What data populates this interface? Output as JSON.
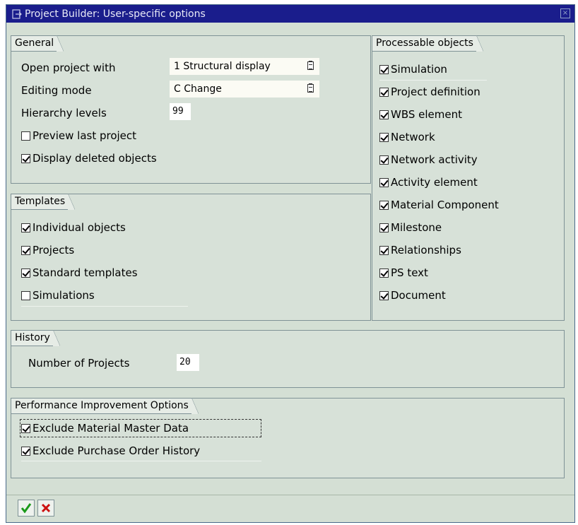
{
  "window": {
    "title": "Project Builder: User-specific options"
  },
  "general": {
    "label": "General",
    "open_project_label": "Open project with",
    "open_project_value": "1 Structural display",
    "editing_mode_label": "Editing mode",
    "editing_mode_value": "C Change",
    "hierarchy_levels_label": "Hierarchy levels",
    "hierarchy_levels_value": "99",
    "preview_last_project": {
      "label": "Preview last project",
      "checked": false
    },
    "display_deleted_objects": {
      "label": "Display deleted objects",
      "checked": true
    }
  },
  "templates": {
    "label": "Templates",
    "items": [
      {
        "label": "Individual objects",
        "checked": true
      },
      {
        "label": "Projects",
        "checked": true
      },
      {
        "label": "Standard templates",
        "checked": true
      },
      {
        "label": "Simulations",
        "checked": false
      }
    ]
  },
  "processable": {
    "label": "Processable objects",
    "items": [
      {
        "label": "Simulation",
        "checked": true
      },
      {
        "label": "Project definition",
        "checked": true
      },
      {
        "label": "WBS element",
        "checked": true
      },
      {
        "label": "Network",
        "checked": true
      },
      {
        "label": "Network activity",
        "checked": true
      },
      {
        "label": "Activity element",
        "checked": true
      },
      {
        "label": "Material Component",
        "checked": true
      },
      {
        "label": "Milestone",
        "checked": true
      },
      {
        "label": "Relationships",
        "checked": true
      },
      {
        "label": "PS text",
        "checked": true
      },
      {
        "label": "Document",
        "checked": true
      }
    ]
  },
  "history": {
    "label": "History",
    "number_of_projects_label": "Number of Projects",
    "number_of_projects_value": "20"
  },
  "performance": {
    "label": "Performance Improvement Options",
    "items": [
      {
        "label": "Exclude Material Master Data",
        "checked": true
      },
      {
        "label": "Exclude Purchase Order History",
        "checked": true
      }
    ]
  },
  "footer": {
    "confirm_icon": "green-checkmark-icon",
    "cancel_icon": "red-x-icon",
    "confirm_color": "#1a9a1a",
    "cancel_color": "#cc1111"
  }
}
